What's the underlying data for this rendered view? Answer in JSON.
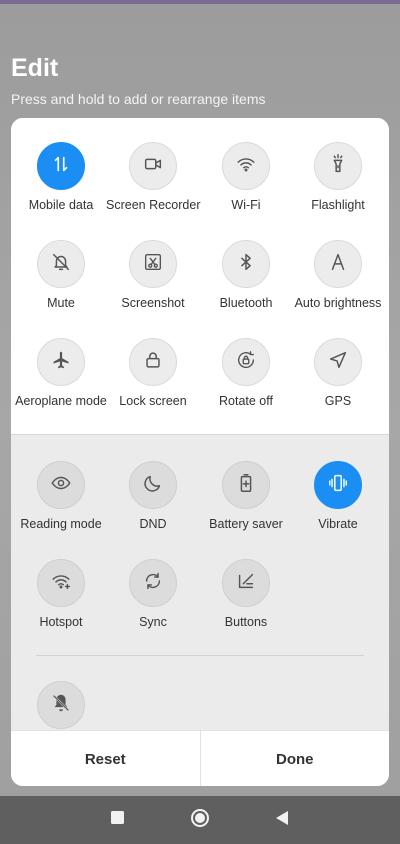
{
  "header": {
    "title": "Edit",
    "subtitle": "Press and hold to add or rearrange items"
  },
  "active_tiles": {
    "tiles": [
      {
        "label": "Mobile data",
        "icon": "mobile-data-icon",
        "active": true
      },
      {
        "label": "Screen Recorder",
        "icon": "video-camera-icon",
        "active": false
      },
      {
        "label": "Wi-Fi",
        "icon": "wifi-icon",
        "active": false
      },
      {
        "label": "Flashlight",
        "icon": "flashlight-icon",
        "active": false
      },
      {
        "label": "Mute",
        "icon": "bell-off-icon",
        "active": false
      },
      {
        "label": "Screenshot",
        "icon": "screenshot-scissors-icon",
        "active": false
      },
      {
        "label": "Bluetooth",
        "icon": "bluetooth-icon",
        "active": false
      },
      {
        "label": "Auto brightness",
        "icon": "letter-a-icon",
        "active": false
      },
      {
        "label": "Aeroplane mode",
        "icon": "airplane-icon",
        "active": false
      },
      {
        "label": "Lock screen",
        "icon": "lock-icon",
        "active": false
      },
      {
        "label": "Rotate off",
        "icon": "rotate-lock-icon",
        "active": false
      },
      {
        "label": "GPS",
        "icon": "navigation-arrow-icon",
        "active": false
      }
    ]
  },
  "available_tiles": {
    "tiles": [
      {
        "label": "Reading mode",
        "icon": "eye-icon",
        "active": false
      },
      {
        "label": "DND",
        "icon": "moon-icon",
        "active": false
      },
      {
        "label": "Battery saver",
        "icon": "battery-plus-icon",
        "active": false
      },
      {
        "label": "Vibrate",
        "icon": "vibrate-icon",
        "active": true
      },
      {
        "label": "Hotspot",
        "icon": "hotspot-icon",
        "active": false
      },
      {
        "label": "Sync",
        "icon": "sync-icon",
        "active": false
      },
      {
        "label": "Buttons",
        "icon": "buttons-icon",
        "active": false
      }
    ],
    "extra_icon": "notification-off-icon"
  },
  "actions": {
    "reset_label": "Reset",
    "done_label": "Done"
  },
  "colors": {
    "accent": "#1a8ef2",
    "icon": "#555555"
  },
  "nav": {
    "recents_icon": "square-icon",
    "home_icon": "circle-home-icon",
    "back_icon": "triangle-back-icon"
  }
}
